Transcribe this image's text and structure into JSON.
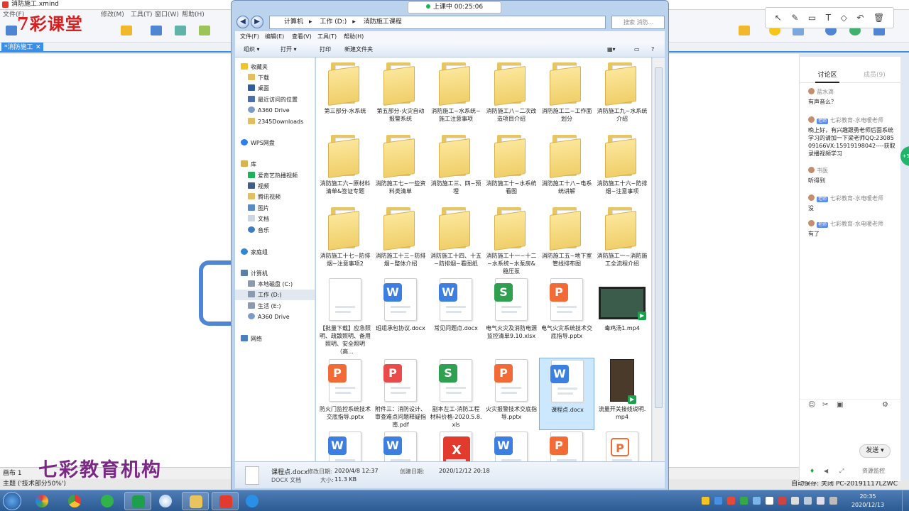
{
  "xmind": {
    "title": "消防施工.xmind",
    "menu": [
      "文件(F)",
      "修改(M)",
      "工具(T)",
      "窗口(W)",
      "帮助(H)"
    ],
    "tab_label": "*消防施工",
    "status_zoom": "画布 1",
    "status_topic": "主题 ('技术部分50%')",
    "status_right": "自动保存: 关闭   PC-20191117LZWC",
    "accent": "#3a8ee6"
  },
  "branding": {
    "top": "7彩课堂",
    "bottom": "七彩教育机构"
  },
  "live": {
    "status": "上课中 00:25:06"
  },
  "explorer": {
    "address": [
      "计算机",
      "工作 (D:)",
      "消防施工课程"
    ],
    "search_placeholder": "搜索 消防...",
    "menu": [
      "文件(F)",
      "编辑(E)",
      "查看(V)",
      "工具(T)",
      "帮助(H)"
    ],
    "commands": {
      "organize": "组织 ▾",
      "open": "打开 ▾",
      "print": "打印",
      "new_folder": "新建文件夹"
    },
    "nav": {
      "favorites": "收藏夹",
      "downloads": "下载",
      "desktop": "桌面",
      "recent": "最近访问的位置",
      "a360": "A360 Drive",
      "dl2345": "2345Downloads",
      "wps": "WPS网盘",
      "library": "库",
      "iqiyi": "爱奇艺热播视频",
      "videos": "视频",
      "tencent": "腾讯视频",
      "pictures": "图片",
      "documents": "文档",
      "music": "音乐",
      "homegroup": "家庭组",
      "computer": "计算机",
      "drive_c": "本地磁盘 (C:)",
      "drive_d": "工作 (D:)",
      "drive_e": "生活 (E:)",
      "a360b": "A360 Drive",
      "network": "网络"
    },
    "files": [
      {
        "name": "第三部分-水系统",
        "kind": "folder"
      },
      {
        "name": "第五部分-火灾自动报警系统",
        "kind": "folder"
      },
      {
        "name": "消防施工~水系统~施工注意事项",
        "kind": "folder"
      },
      {
        "name": "消防施工八~二次改造项目介绍",
        "kind": "folder"
      },
      {
        "name": "消防施工二~工作面划分",
        "kind": "folder"
      },
      {
        "name": "消防施工九~水系统介绍",
        "kind": "folder"
      },
      {
        "name": "消防施工六~原材料清单&签证专题",
        "kind": "folder"
      },
      {
        "name": "消防施工七~一些资料类清单",
        "kind": "folder"
      },
      {
        "name": "消防施工三、四~预埋",
        "kind": "folder"
      },
      {
        "name": "消防施工十~水系统看图",
        "kind": "folder"
      },
      {
        "name": "消防施工十八~电系统讲解",
        "kind": "folder"
      },
      {
        "name": "消防施工十六~防排烟~注意事项",
        "kind": "folder"
      },
      {
        "name": "消防施工十七~防排烟~注意事项2",
        "kind": "folder"
      },
      {
        "name": "消防施工十三~防排烟~整体介绍",
        "kind": "folder"
      },
      {
        "name": "消防施工十四、十五~防排烟~看图纸",
        "kind": "folder"
      },
      {
        "name": "消防施工十一~十二~水系统~水泵房&稳压泵",
        "kind": "folder"
      },
      {
        "name": "消防施工五~地下室管线排布图",
        "kind": "folder"
      },
      {
        "name": "消防施工一~消防施工全流程介绍",
        "kind": "folder"
      },
      {
        "name": "【批量下载】应急照明、疏散照明、备用照明、安全照明（高...",
        "kind": "blank"
      },
      {
        "name": "班组承包协议.docx",
        "kind": "docx"
      },
      {
        "name": "常见问题点.docx",
        "kind": "docx"
      },
      {
        "name": "电气火灾及消防电源监控清单9.10.xlsx",
        "kind": "xlsx"
      },
      {
        "name": "电气火灾系统技术交底指导.pptx",
        "kind": "pptx"
      },
      {
        "name": "毒鸡汤1.mp4",
        "kind": "mp4"
      },
      {
        "name": "防火门监控系统技术交底指导.pptx",
        "kind": "pptx"
      },
      {
        "name": "附件三：消防设计、审查难点问题释疑指南.pdf",
        "kind": "pdf"
      },
      {
        "name": "副本左工-消防工程材料价格-2020.5.8.xls",
        "kind": "xls"
      },
      {
        "name": "火灾报警技术交底指导.pptx",
        "kind": "pptx"
      },
      {
        "name": "课程点.docx",
        "kind": "docx",
        "selected": true
      },
      {
        "name": "流量开关接线说明.mp4",
        "kind": "mp4v"
      },
      {
        "name": "",
        "kind": "docx"
      },
      {
        "name": "",
        "kind": "docx"
      },
      {
        "name": "",
        "kind": "xmind"
      },
      {
        "name": "",
        "kind": "docx"
      },
      {
        "name": "",
        "kind": "pptx"
      },
      {
        "name": "",
        "kind": "pptx2"
      }
    ],
    "details": {
      "name": "课程点.docx",
      "type": "DOCX 文档",
      "modified_label": "修改日期:",
      "modified": "2020/4/8 12:37",
      "created_label": "创建日期:",
      "created": "2020/12/12 20:18",
      "size_label": "大小:",
      "size": "11.3 KB"
    }
  },
  "chat": {
    "tab_discussion": "讨论区",
    "tab_members": "成员(9)",
    "messages": [
      {
        "name": "蓝水滴",
        "teacher": false,
        "text": "有声音么？"
      },
      {
        "name": "七彩教育-水电暖老师",
        "teacher": true,
        "text": "晚上好，有兴趣跟勇老师后面系统学习的请加一下梁老师QQ:2308509166VX:15919198042----获取录播视频学习"
      },
      {
        "name": "书医",
        "teacher": false,
        "text": "听得到"
      },
      {
        "name": "七彩教育-水电暖老师",
        "teacher": true,
        "text": "没"
      },
      {
        "name": "七彩教育-水电暖老师",
        "teacher": true,
        "text": "有了"
      }
    ],
    "teacher_tag": "老师",
    "send": "发送",
    "monitor": "资源监控",
    "badge": "+5"
  },
  "taskbar": {
    "time": "20:35",
    "date": "2020/12/13"
  }
}
